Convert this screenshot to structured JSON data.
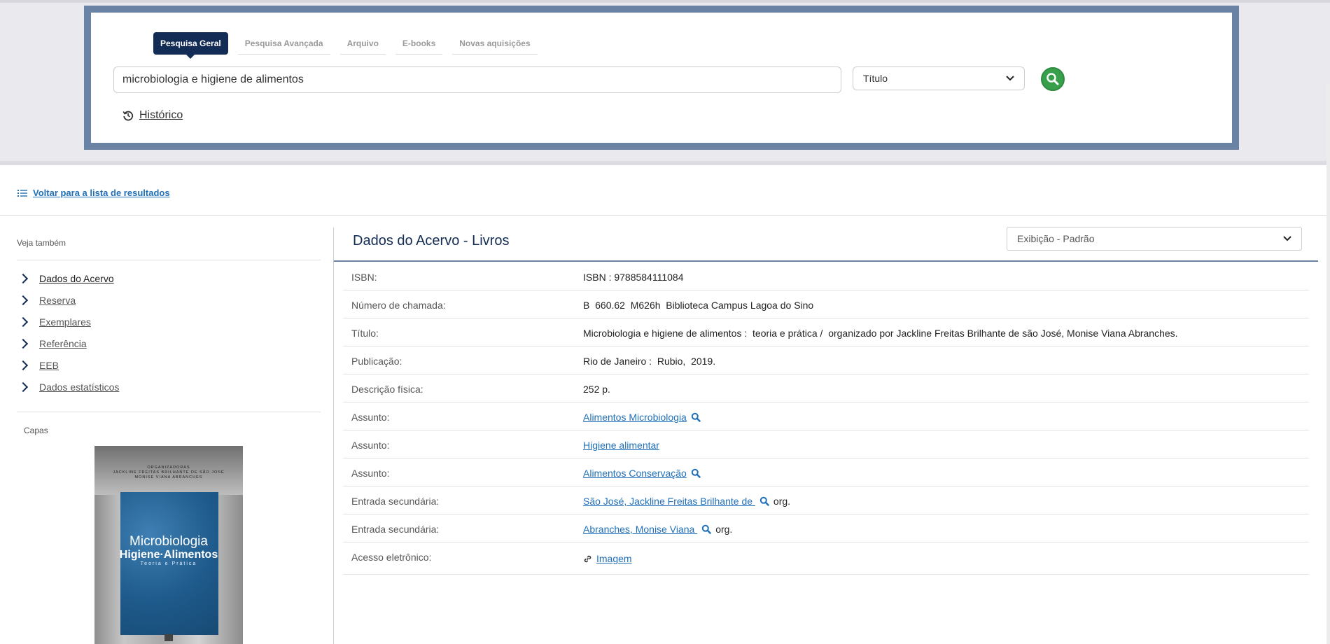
{
  "search": {
    "tabs": [
      {
        "label": "Pesquisa Geral",
        "active": true
      },
      {
        "label": "Pesquisa Avançada",
        "active": false
      },
      {
        "label": "Arquivo",
        "active": false
      },
      {
        "label": "E-books",
        "active": false
      },
      {
        "label": "Novas aquisições",
        "active": false
      }
    ],
    "query": "microbiologia e higiene de alimentos",
    "field_select": "Título",
    "history_label": "Histórico"
  },
  "back_link": "Voltar para a lista de resultados",
  "sidebar": {
    "heading": "Veja também",
    "items": [
      {
        "label": "Dados do Acervo",
        "active": true
      },
      {
        "label": "Reserva",
        "active": false
      },
      {
        "label": "Exemplares",
        "active": false
      },
      {
        "label": "Referência",
        "active": false
      },
      {
        "label": "EEB",
        "active": false
      },
      {
        "label": "Dados estatísticos",
        "active": false
      }
    ],
    "covers_heading": "Capas",
    "cover": {
      "credits_line1": "ORGANIZADORAS",
      "credits_line2": "JACKLINE FREITAS BRILHANTE DE SÃO JOSÉ",
      "credits_line3": "MONISE VIANA ABRANCHES",
      "title1": "Microbiologia",
      "title2": "Higiene·Alimentos",
      "title3": "Teoria e Prática"
    }
  },
  "main": {
    "title": "Dados do Acervo - Livros",
    "view_select": "Exibição - Padrão",
    "fields": [
      {
        "label": "ISBN:",
        "value": "ISBN : 9788584111084"
      },
      {
        "label": "Número de chamada:",
        "value": "B  660.62  M626h  Biblioteca Campus Lagoa do Sino"
      },
      {
        "label": "Título:",
        "value": "Microbiologia e higiene de alimentos :  teoria e prática /  organizado por Jackline Freitas Brilhante de são José, Monise Viana Abranches."
      },
      {
        "label": "Publicação:",
        "value": "Rio de Janeiro :  Rubio,  2019."
      },
      {
        "label": "Descrição física:",
        "value": "252 p."
      },
      {
        "label": "Assunto:",
        "link": "Alimentos Microbiologia",
        "search_icon": true
      },
      {
        "label": "Assunto:",
        "link": "Higiene alimentar",
        "search_icon": false
      },
      {
        "label": "Assunto:",
        "link": "Alimentos Conservação",
        "search_icon": true
      },
      {
        "label": "Entrada secundária:",
        "link": "São José, Jackline Freitas Brilhante de ",
        "search_icon": true,
        "suffix": "org."
      },
      {
        "label": "Entrada secundária:",
        "link": "Abranches, Monise Viana ",
        "search_icon": true,
        "suffix": "org."
      },
      {
        "label": "Acesso eletrônico:",
        "link": "Imagem",
        "link_icon": true
      }
    ]
  },
  "colors": {
    "navy": "#132c55",
    "frame": "#6a83a5",
    "link": "#1f6fb8",
    "search_button": "#38a04b"
  }
}
